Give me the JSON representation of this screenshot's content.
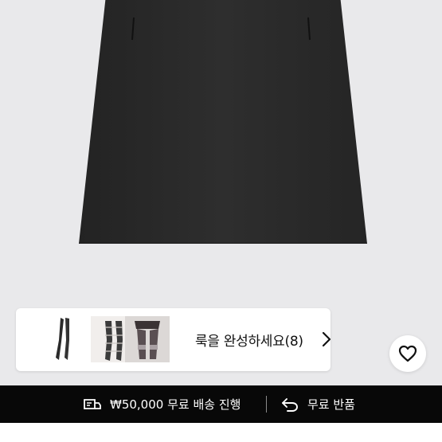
{
  "product": {
    "image_name": "black-mini-skirt"
  },
  "look_card": {
    "label": "룩을 완성하세요(8)",
    "thumbnails": [
      "black-tights",
      "patterned-tights",
      "garter-tights"
    ],
    "arrow_icon": "chevron-right-icon"
  },
  "wishlist": {
    "icon": "heart-icon"
  },
  "bottom_bar": {
    "shipping_text": "₩50,000 무료 배송 진행",
    "shipping_icon": "delivery-truck-icon",
    "return_text": "무료 반품",
    "return_icon": "return-arrow-icon"
  },
  "colors": {
    "background": "#e9e9eb",
    "bar": "#080808",
    "skirt": "#2b2b2b"
  }
}
